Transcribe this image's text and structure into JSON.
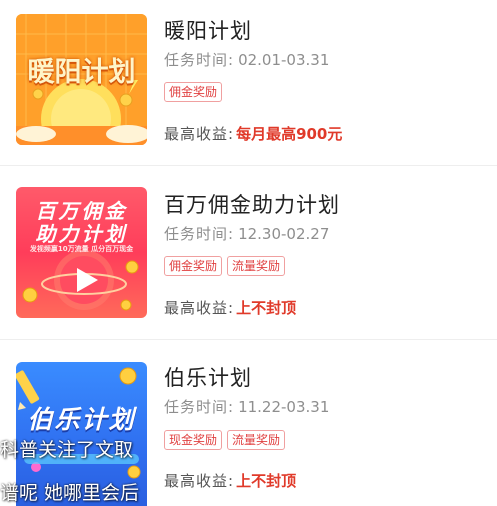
{
  "plans": [
    {
      "title": "暖阳计划",
      "period_label": "任务时间:",
      "period_value": "02.01-03.31",
      "tags": [
        "佣金奖励"
      ],
      "income_label": "最高收益:",
      "income_value": "每月最高900元",
      "thumb_title": "暖阳计划"
    },
    {
      "title": "百万佣金助力计划",
      "period_label": "任务时间:",
      "period_value": "12.30-02.27",
      "tags": [
        "佣金奖励",
        "流量奖励"
      ],
      "income_label": "最高收益:",
      "income_value": "上不封顶",
      "thumb_line1": "百万佣金",
      "thumb_line2": "助力计划",
      "thumb_sub": "发视频赢10万流量  瓜分百万现金"
    },
    {
      "title": "伯乐计划",
      "period_label": "任务时间:",
      "period_value": "11.22-03.31",
      "tags": [
        "现金奖励",
        "流量奖励"
      ],
      "income_label": "最高收益:",
      "income_value": "上不封顶",
      "thumb_title": "伯乐计划"
    }
  ],
  "overlay": {
    "line1": "科普关注了文取",
    "line2": "谱呢 她哪里会后"
  },
  "colors": {
    "accent_red": "#e03a2a",
    "tag_border": "#f0a0a0",
    "title_text": "#222222",
    "muted_text": "#8e8e8e"
  }
}
